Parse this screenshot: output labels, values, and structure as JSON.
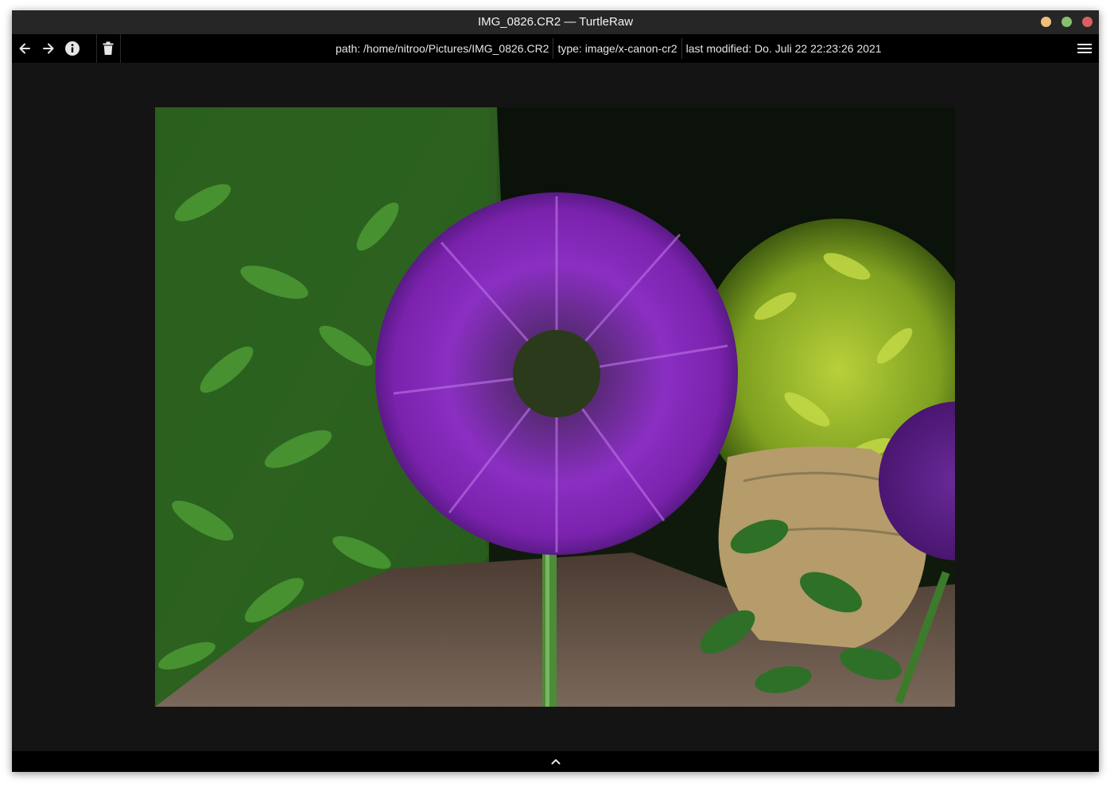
{
  "window": {
    "title": "IMG_0826.CR2 — TurtleRaw",
    "controls": [
      {
        "name": "minimize",
        "color": "#f0c07a"
      },
      {
        "name": "maximize",
        "color": "#88c070"
      },
      {
        "name": "close",
        "color": "#d96060"
      }
    ]
  },
  "toolbar": {
    "icons": [
      "arrow-left-icon",
      "arrow-right-icon",
      "info-icon",
      "trash-icon",
      "hamburger-menu-icon"
    ],
    "path": "path:  /home/nitroo/Pictures/IMG_0826.CR2",
    "type": "type:  image/x-canon-cr2",
    "modified": "last modified:  Do. Juli 22 22:23:26 2021"
  },
  "bottombar": {
    "icon": "chevron-up-icon"
  },
  "colors": {
    "background": "#141414",
    "toolbar": "#000000",
    "titlebar": "#262626",
    "text": "#e6e6e6"
  }
}
